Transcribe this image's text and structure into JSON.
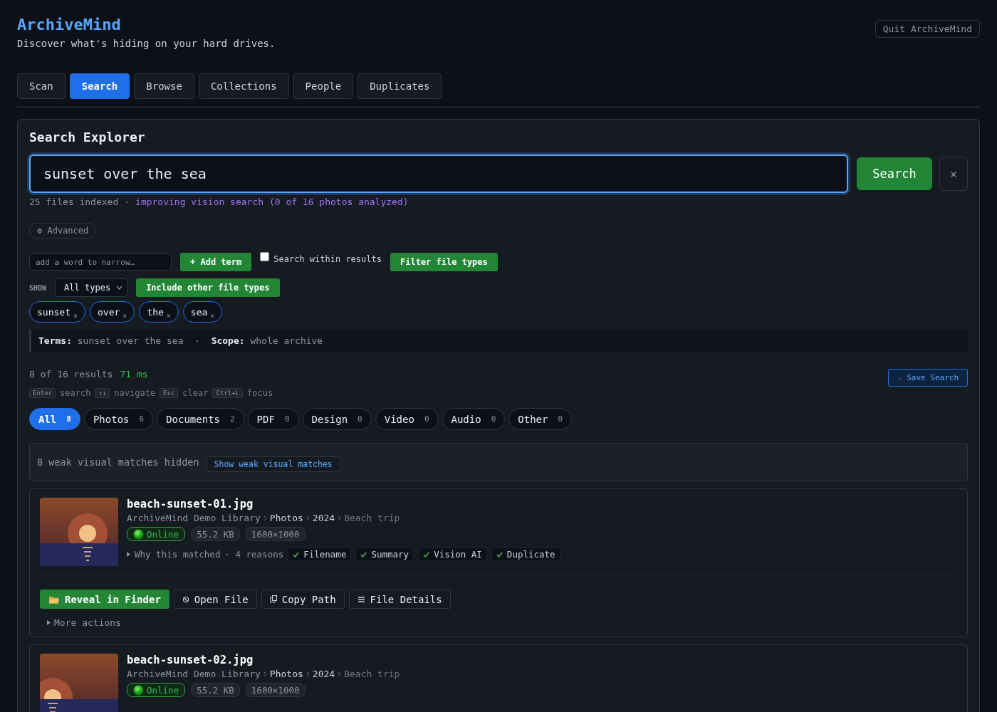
{
  "app": {
    "title": "ArchiveMind",
    "subtitle": "Discover what's hiding on your hard drives.",
    "quit_button": "Quit ArchiveMind"
  },
  "tabs": [
    {
      "label": "Scan",
      "selected": false
    },
    {
      "label": "Search",
      "selected": true
    },
    {
      "label": "Browse",
      "selected": false
    },
    {
      "label": "Collections",
      "selected": false
    },
    {
      "label": "People",
      "selected": false
    },
    {
      "label": "Duplicates",
      "selected": false
    }
  ],
  "search": {
    "heading": "Search Explorer",
    "query": "sunset over the sea",
    "search_button": "Search",
    "clear_button": "×",
    "indexed": "25 files indexed",
    "separator": "·",
    "vision_status": "improving vision search (0 of 16 photos analyzed)",
    "advanced_button": "⚙ Advanced"
  },
  "narrow": {
    "placeholder": "add a word to narrow…",
    "add_button": "+ Add term",
    "within_label": "Search within results",
    "within_checked": false,
    "filter_button": "Filter file types"
  },
  "show": {
    "label": "SHOW",
    "select": "All types",
    "include_button": "Include other file types"
  },
  "terms": [
    {
      "label": "sunset",
      "remove": "×"
    },
    {
      "label": "over",
      "remove": "×"
    },
    {
      "label": "the",
      "remove": "×"
    },
    {
      "label": "sea",
      "remove": "×"
    }
  ],
  "summary": "**Terms:** sunset over the sea  ·  **Scope:** whole archive",
  "results_info": {
    "count": "8 of 16 results",
    "timing": "71 ms",
    "save_button": "☆ Save Search"
  },
  "shortcuts": [
    {
      "key": "Enter",
      "action": "search"
    },
    {
      "key": "↑↓",
      "action": "navigate"
    },
    {
      "key": "Esc",
      "action": "clear"
    },
    {
      "key": "Ctrl+L",
      "action": "focus"
    }
  ],
  "filters": [
    {
      "label": "All",
      "count": "8",
      "selected": true
    },
    {
      "label": "Photos",
      "count": "6",
      "selected": false
    },
    {
      "label": "Documents",
      "count": "2",
      "selected": false
    },
    {
      "label": "PDF",
      "count": "0",
      "selected": false
    },
    {
      "label": "Design",
      "count": "0",
      "selected": false
    },
    {
      "label": "Video",
      "count": "0",
      "selected": false
    },
    {
      "label": "Audio",
      "count": "0",
      "selected": false
    },
    {
      "label": "Other",
      "count": "0",
      "selected": false
    }
  ],
  "weak_matches": {
    "message": "8 weak visual matches hidden",
    "button": "Show weak visual matches"
  },
  "results": [
    {
      "name": "beach-sunset-01.jpg",
      "path": [
        "ArchiveMind Demo Library",
        "Photos",
        "2024",
        "Beach trip"
      ],
      "status": "Online",
      "online": true,
      "size": "55.2 KB",
      "dimensions": "1600×1000",
      "why": "Why this matched",
      "reasons_count": "· 4 reasons",
      "reasons": [
        "Filename",
        "Summary",
        "Vision AI",
        "Duplicate"
      ],
      "actions": [
        {
          "kind": "folder",
          "label": "Reveal in Finder",
          "primary": true
        },
        {
          "kind": "open",
          "label": "Open File",
          "primary": false
        },
        {
          "kind": "copy",
          "label": "Copy Path",
          "primary": false
        },
        {
          "kind": "list",
          "label": "File Details",
          "primary": false
        }
      ],
      "more": "More actions"
    },
    {
      "name": "beach-sunset-02.jpg",
      "path": [
        "ArchiveMind Demo Library",
        "Photos",
        "2024",
        "Beach trip"
      ],
      "status": "Online",
      "online": true,
      "size": "55.2 KB",
      "dimensions": "1600×1000"
    }
  ]
}
